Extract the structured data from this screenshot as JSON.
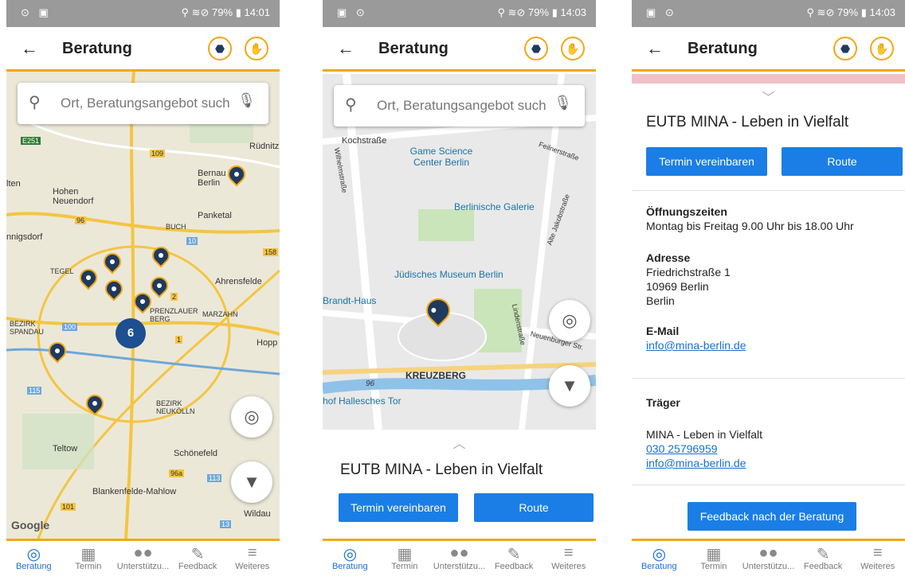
{
  "status": {
    "screen1": {
      "left": "⊙ ▣",
      "right": "⚲ ≋⊘ 79% ▮ 14:01"
    },
    "screen2": {
      "left": "▣ ⊙",
      "right": "⚲ ≋⊘ 79% ▮ 14:03"
    },
    "screen3": {
      "left": "▣ ⊙",
      "right": "⚲ ≋⊘ 79% ▮ 14:03"
    }
  },
  "appbar": {
    "title": "Beratung",
    "back_icon": "←",
    "icon1": "⬣",
    "icon2": "✋"
  },
  "search": {
    "placeholder": "Ort, Beratungsangebot such"
  },
  "map1": {
    "cluster_count": "6",
    "labels": [
      "Rüdnitz",
      "Bernau bei Berlin",
      "Hohen Neuendorf",
      "Panketal",
      "BUCH",
      "Ahrensfelde",
      "TEGEL",
      "MARZAHN",
      "PRENZLAUER BERG",
      "BEZIRK SPANDAU",
      "Hopp",
      "BEZIRK NEUKÖLLN",
      "Teltow",
      "Schönefeld",
      "Blankenfelde-Mahlow",
      "Wildau",
      "Google",
      "lten",
      "nnigsdorf",
      "E251"
    ],
    "road_numbers": [
      "109",
      "96",
      "10",
      "158",
      "2",
      "100",
      "1",
      "115",
      "96a",
      "113",
      "101",
      "13"
    ]
  },
  "map2": {
    "labels": [
      "Kochstraße",
      "Game Science Center Berlin",
      "Berlinische Galerie",
      "Jüdisches Museum Berlin",
      "Brandt-Haus",
      "KREUZBERG",
      "hof Hallesches Tor",
      "Lindenstraße",
      "Alte Jakobstraße",
      "Wilhelmstraße",
      "Feilnerstraße",
      "Neuenburger Str."
    ],
    "road_numbers": [
      "96"
    ]
  },
  "place": {
    "name": "EUTB MINA - Leben in Vielfalt",
    "btn_termin": "Termin vereinbaren",
    "btn_route": "Route"
  },
  "details": {
    "hours_label": "Öffnungszeiten",
    "hours_value": "Montag bis Freitag 9.00 Uhr bis 18.00 Uhr",
    "address_label": "Adresse",
    "address_line1": "Friedrichstraße 1",
    "address_line2": "10969 Berlin",
    "address_line3": "Berlin",
    "email_label": "E-Mail",
    "email_value": "info@mina-berlin.de",
    "traeger_label": "Träger",
    "traeger_name": "MINA - Leben in Vielfalt",
    "traeger_phone": "030 25796959",
    "traeger_email": "info@mina-berlin.de",
    "feedback_button": "Feedback nach der Beratung"
  },
  "nav": [
    {
      "label": "Beratung",
      "icon": "◎"
    },
    {
      "label": "Termin",
      "icon": "▦"
    },
    {
      "label": "Unterstützu...",
      "icon": "●●"
    },
    {
      "label": "Feedback",
      "icon": "✎"
    },
    {
      "label": "Weiteres",
      "icon": "≡"
    }
  ],
  "colors": {
    "accent": "#f3a712",
    "primary": "#1a7ee6",
    "marker": "#1f3a5f",
    "cluster": "#1d4f91"
  }
}
